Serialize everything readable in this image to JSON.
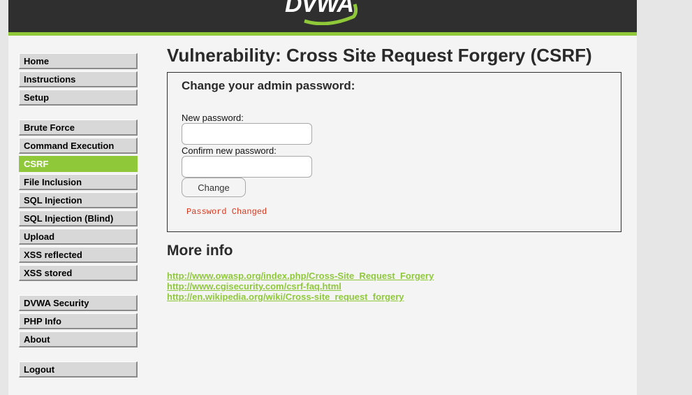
{
  "header": {
    "logo_text": "DVWA"
  },
  "menu": {
    "group1": [
      {
        "label": "Home"
      },
      {
        "label": "Instructions"
      },
      {
        "label": "Setup"
      }
    ],
    "group2": [
      {
        "label": "Brute Force"
      },
      {
        "label": "Command Execution"
      },
      {
        "label": "CSRF",
        "selected": true
      },
      {
        "label": "File Inclusion"
      },
      {
        "label": "SQL Injection"
      },
      {
        "label": "SQL Injection (Blind)"
      },
      {
        "label": "Upload"
      },
      {
        "label": "XSS reflected"
      },
      {
        "label": "XSS stored"
      }
    ],
    "group3": [
      {
        "label": "DVWA Security"
      },
      {
        "label": "PHP Info"
      },
      {
        "label": "About"
      }
    ],
    "group4": [
      {
        "label": "Logout"
      }
    ]
  },
  "main": {
    "title": "Vulnerability: Cross Site Request Forgery (CSRF)",
    "form": {
      "heading": "Change your admin password:",
      "new_password_label": "New password:",
      "new_password_value": "",
      "confirm_password_label": "Confirm new password:",
      "confirm_password_value": "",
      "submit_label": "Change",
      "status_message": "Password Changed"
    },
    "more_info": {
      "heading": "More info",
      "links": [
        "http://www.owasp.org/index.php/Cross-Site_Request_Forgery",
        "http://www.cgisecurity.com/csrf-faq.html",
        "http://en.wikipedia.org/wiki/Cross-site_request_forgery"
      ]
    }
  },
  "colors": {
    "accent": "#8fc93a",
    "header_bg": "#2f2f2f",
    "status_text": "#d9381e"
  }
}
